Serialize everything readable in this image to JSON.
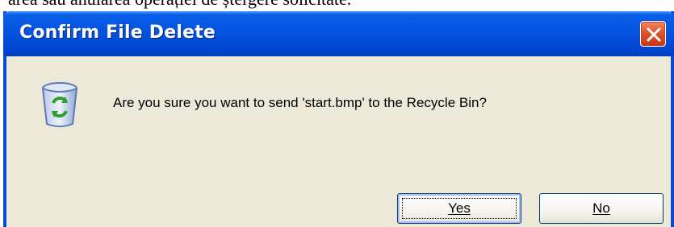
{
  "page_caption": "area sau anularea operației de ștergere solicitate.",
  "dialog": {
    "title": "Confirm File Delete",
    "message": "Are you sure you want to send 'start.bmp' to the Recycle Bin?",
    "buttons": {
      "yes": "Yes",
      "no": "No"
    },
    "icon": "recycle-bin-icon",
    "close_icon": "close-icon"
  },
  "colors": {
    "titlebar": "#0555e3",
    "dialog_bg": "#ece9d8",
    "close_button": "#e0522c"
  }
}
